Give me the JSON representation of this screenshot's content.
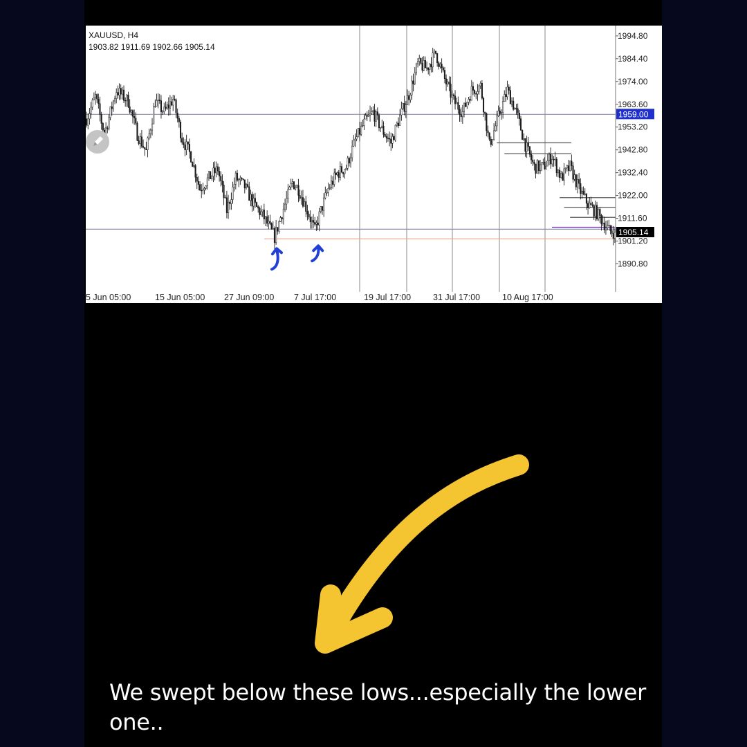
{
  "chart_data": {
    "type": "candlestick",
    "symbol": "XAUUSD, H4",
    "ohlc_readout": "1903.82 1911.69 1902.66 1905.14",
    "y_ticks": [
      1994.8,
      1984.4,
      1974.0,
      1963.6,
      1953.2,
      1942.8,
      1932.4,
      1922.0,
      1911.6,
      1901.2,
      1890.8
    ],
    "ylim": [
      1878.0,
      1999.5
    ],
    "x_ticks": [
      "5 Jun 05:00",
      "15 Jun 05:00",
      "27 Jun 09:00",
      "7 Jul 17:00",
      "19 Jul 17:00",
      "31 Jul 17:00",
      "10 Aug 17:00"
    ],
    "price_path": [
      [
        0,
        1957
      ],
      [
        6,
        1967
      ],
      [
        12,
        1950
      ],
      [
        20,
        1970
      ],
      [
        28,
        1965
      ],
      [
        34,
        1950
      ],
      [
        40,
        1942
      ],
      [
        46,
        1965
      ],
      [
        52,
        1960
      ],
      [
        58,
        1966
      ],
      [
        64,
        1948
      ],
      [
        70,
        1940
      ],
      [
        76,
        1925
      ],
      [
        82,
        1930
      ],
      [
        88,
        1934
      ],
      [
        94,
        1915
      ],
      [
        100,
        1930
      ],
      [
        106,
        1926
      ],
      [
        112,
        1918
      ],
      [
        118,
        1913
      ],
      [
        122,
        1908
      ],
      [
        126,
        1903
      ],
      [
        130,
        1912
      ],
      [
        134,
        1920
      ],
      [
        138,
        1928
      ],
      [
        142,
        1925
      ],
      [
        148,
        1915
      ],
      [
        153,
        1906
      ],
      [
        157,
        1915
      ],
      [
        162,
        1925
      ],
      [
        168,
        1932
      ],
      [
        174,
        1935
      ],
      [
        180,
        1947
      ],
      [
        186,
        1955
      ],
      [
        192,
        1960
      ],
      [
        198,
        1952
      ],
      [
        204,
        1946
      ],
      [
        210,
        1958
      ],
      [
        216,
        1968
      ],
      [
        222,
        1982
      ],
      [
        228,
        1980
      ],
      [
        234,
        1987
      ],
      [
        240,
        1975
      ],
      [
        246,
        1965
      ],
      [
        252,
        1960
      ],
      [
        258,
        1970
      ],
      [
        264,
        1972
      ],
      [
        270,
        1945
      ],
      [
        276,
        1958
      ],
      [
        282,
        1970
      ],
      [
        288,
        1960
      ],
      [
        294,
        1945
      ],
      [
        300,
        1935
      ],
      [
        306,
        1935
      ],
      [
        312,
        1940
      ],
      [
        318,
        1930
      ],
      [
        324,
        1935
      ],
      [
        330,
        1925
      ],
      [
        336,
        1918
      ],
      [
        342,
        1914
      ],
      [
        346,
        1910
      ],
      [
        350,
        1906
      ],
      [
        354,
        1905.14
      ]
    ],
    "n_candles": 355,
    "current_price": 1905.14,
    "highlight_level": 1959.0,
    "horizontal_levels": [
      {
        "price": 1959.0,
        "color": "#8c8fa6"
      },
      {
        "price": 1906.6,
        "color": "#8c8fa6"
      },
      {
        "price": 1902.2,
        "color": "#e8a58c"
      }
    ],
    "resistance_stubs": [
      {
        "price": 1946.0,
        "from": 275,
        "to": 330
      },
      {
        "price": 1941.0,
        "from": 280,
        "to": 330
      },
      {
        "price": 1921.0,
        "from": 317,
        "to": 354
      },
      {
        "price": 1916.5,
        "from": 320,
        "to": 354
      },
      {
        "price": 1912.0,
        "from": 324,
        "to": 354
      }
    ],
    "sweep_marks": [
      {
        "name": "first-low",
        "candle": 126
      },
      {
        "name": "second-low",
        "candle": 153
      }
    ],
    "grid": true
  },
  "colors": {
    "background": "#06091e",
    "panel": "#000000",
    "chart_bg": "#ffffff",
    "candles": "#1a1a1a",
    "highlight_label_bg": "#1f2fcc",
    "current_label_bg": "#000000",
    "sweep_arrow": "#1f3fd6",
    "annotation_arrow": "#f5c431",
    "caption": "#ffffff"
  },
  "icons": {
    "pencil": "pencil-icon"
  },
  "caption": "We swept below these lows...especially the lower one.."
}
